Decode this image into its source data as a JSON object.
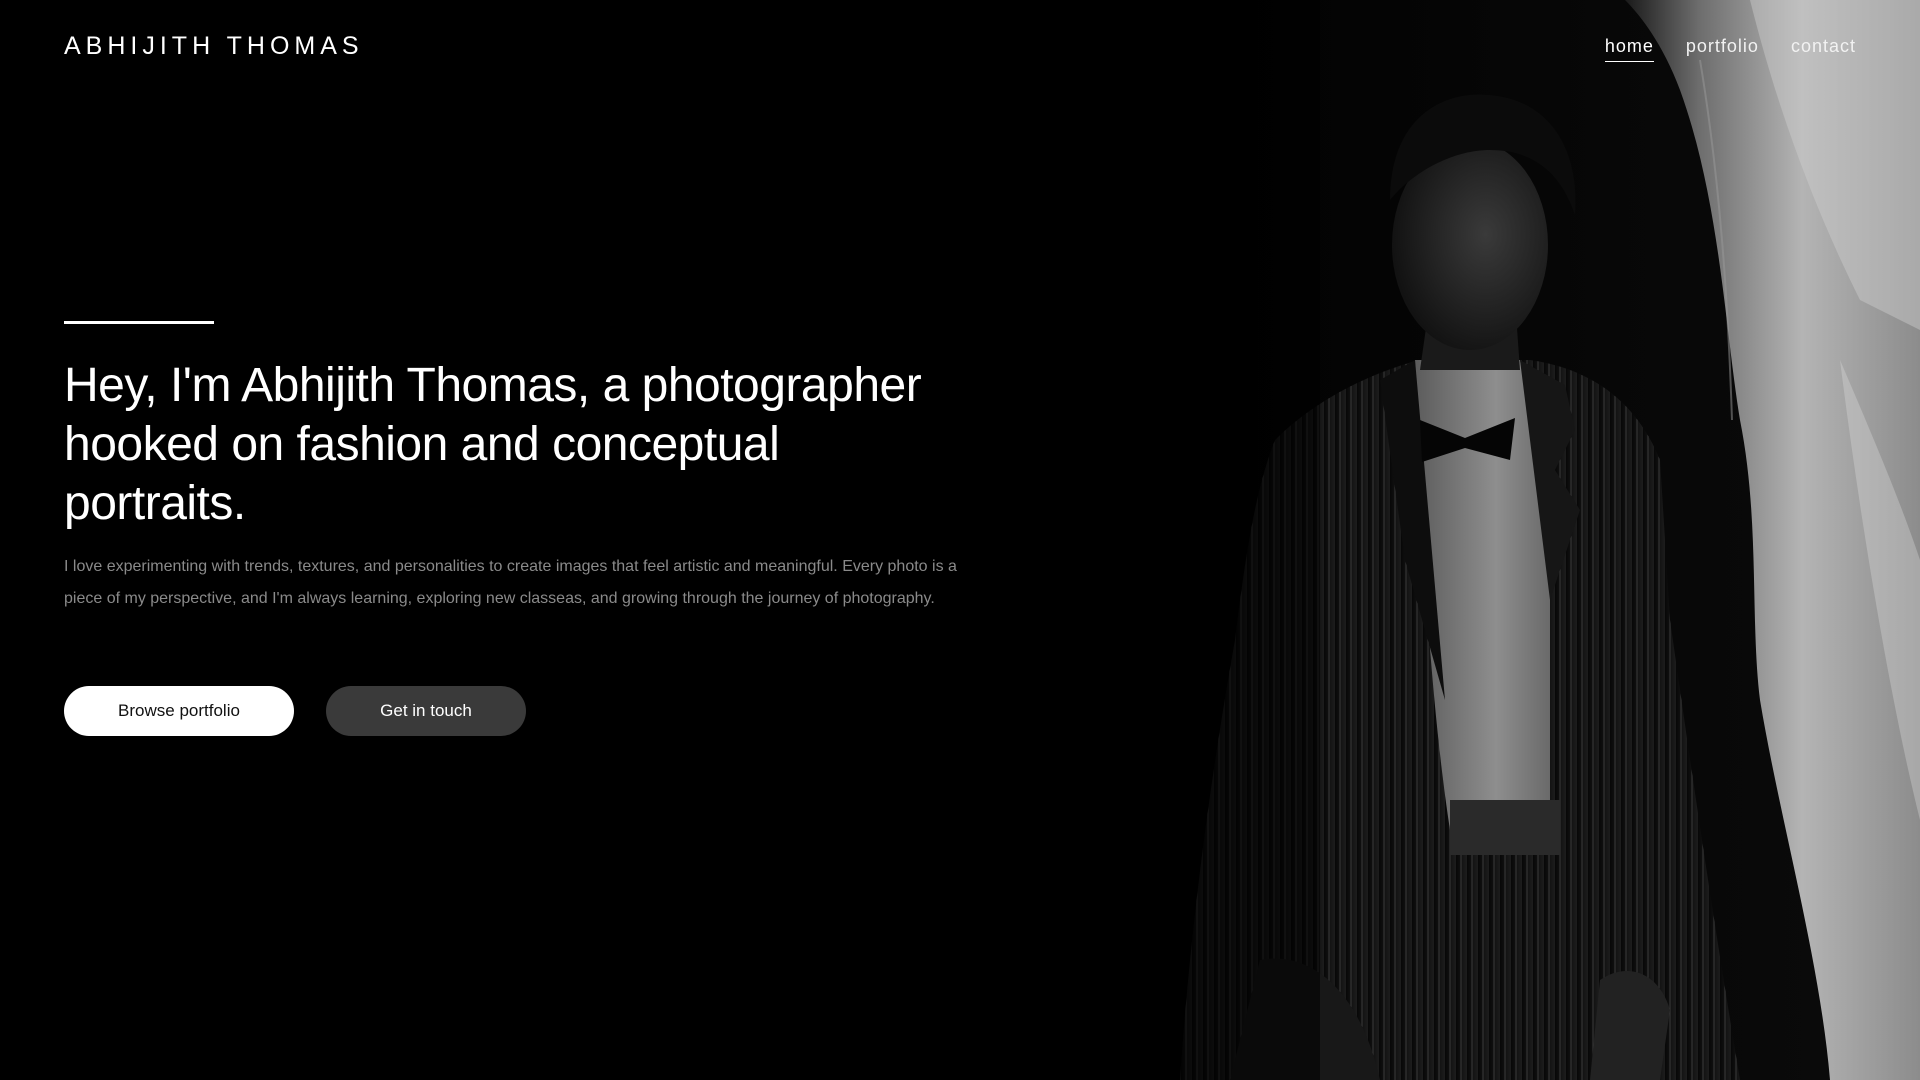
{
  "header": {
    "brand": "ABHIJITH THOMAS",
    "nav": [
      {
        "label": "home",
        "active": true
      },
      {
        "label": "portfolio",
        "active": false
      },
      {
        "label": "contact",
        "active": false
      }
    ]
  },
  "hero": {
    "headline": "Hey, I'm Abhijith Thomas, a photographer hooked on fashion and conceptual portraits.",
    "intro": "I love experimenting with trends, textures, and personalities to create images that feel artistic and meaningful. Every photo is a piece of my perspective, and I'm always learning, exploring new classeas, and growing through the journey of photography.",
    "primary_button": "Browse portfolio",
    "secondary_button": "Get in touch"
  },
  "colors": {
    "background": "#000000",
    "text": "#ffffff",
    "muted_text": "#8a8a8a",
    "primary_button_bg": "#ffffff",
    "secondary_button_bg": "#3a3a3a"
  }
}
